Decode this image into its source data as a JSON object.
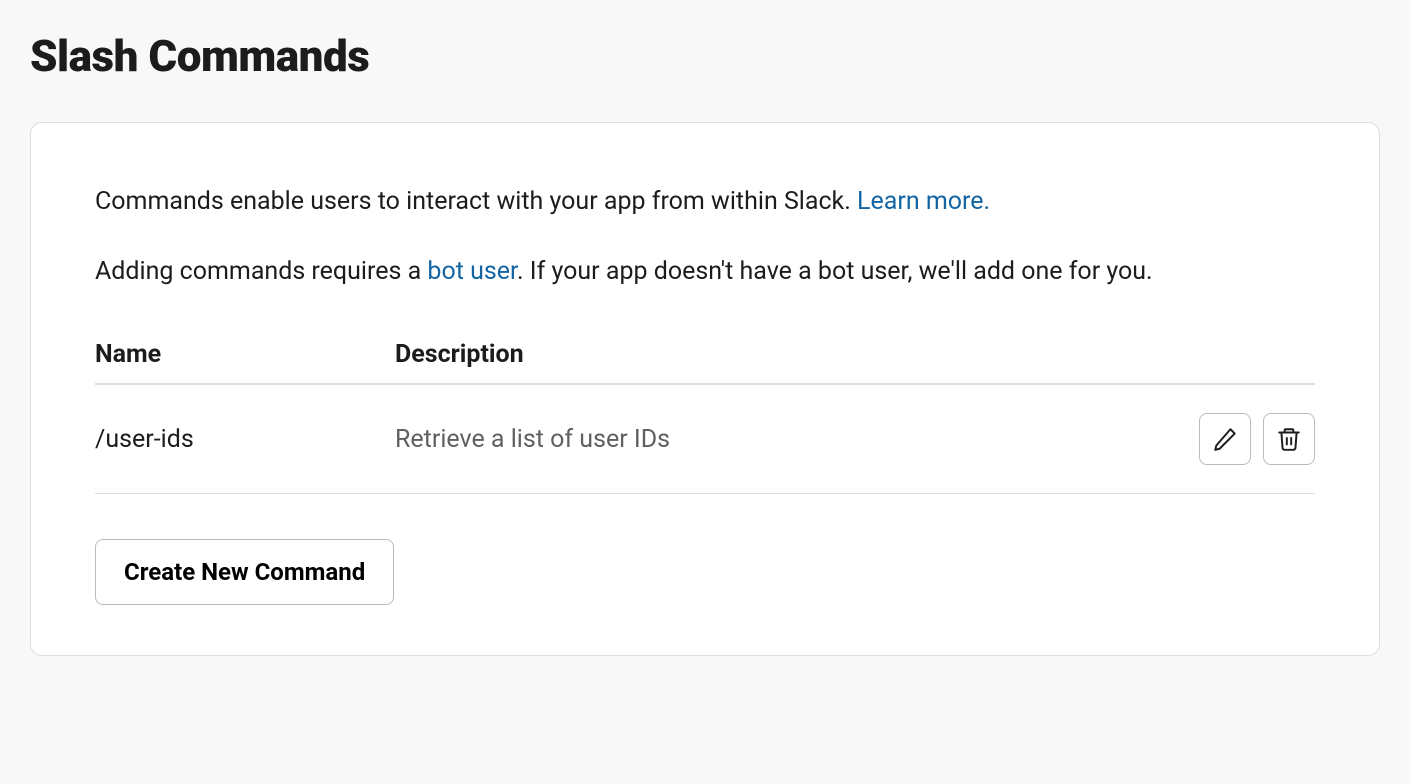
{
  "page_title": "Slash Commands",
  "intro": {
    "paragraph1_before_link": "Commands enable users to interact with your app from within Slack. ",
    "learn_more": "Learn more.",
    "paragraph2_before_link": "Adding commands requires a ",
    "bot_user_link": "bot user",
    "paragraph2_after_link": ". If your app doesn't have a bot user, we'll add one for you."
  },
  "table": {
    "headers": {
      "name": "Name",
      "description": "Description"
    },
    "rows": [
      {
        "name": "/user-ids",
        "description": "Retrieve a list of user IDs"
      }
    ]
  },
  "create_button_label": "Create New Command"
}
